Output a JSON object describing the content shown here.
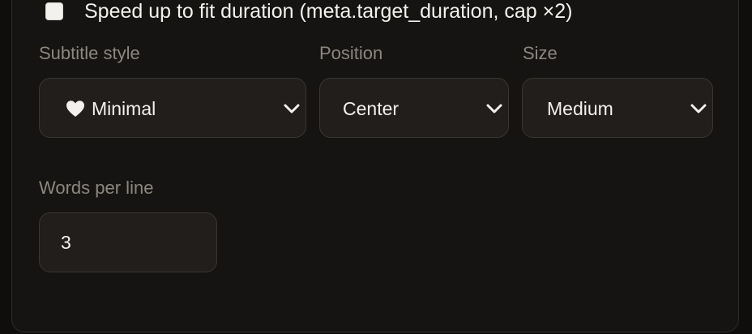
{
  "speedup": {
    "checked": false,
    "label": "Speed up to fit duration (meta.target_duration, cap ×2)"
  },
  "subtitle_style": {
    "label": "Subtitle style",
    "value": "Minimal",
    "icon": "white-heart-icon"
  },
  "position": {
    "label": "Position",
    "value": "Center"
  },
  "size": {
    "label": "Size",
    "value": "Medium"
  },
  "words_per_line": {
    "label": "Words per line",
    "value": "3"
  },
  "colors": {
    "background": "#161412",
    "field_bg": "#211e1b",
    "border": "#3a3632",
    "text": "#f3f1ee",
    "label": "#8b8680"
  }
}
